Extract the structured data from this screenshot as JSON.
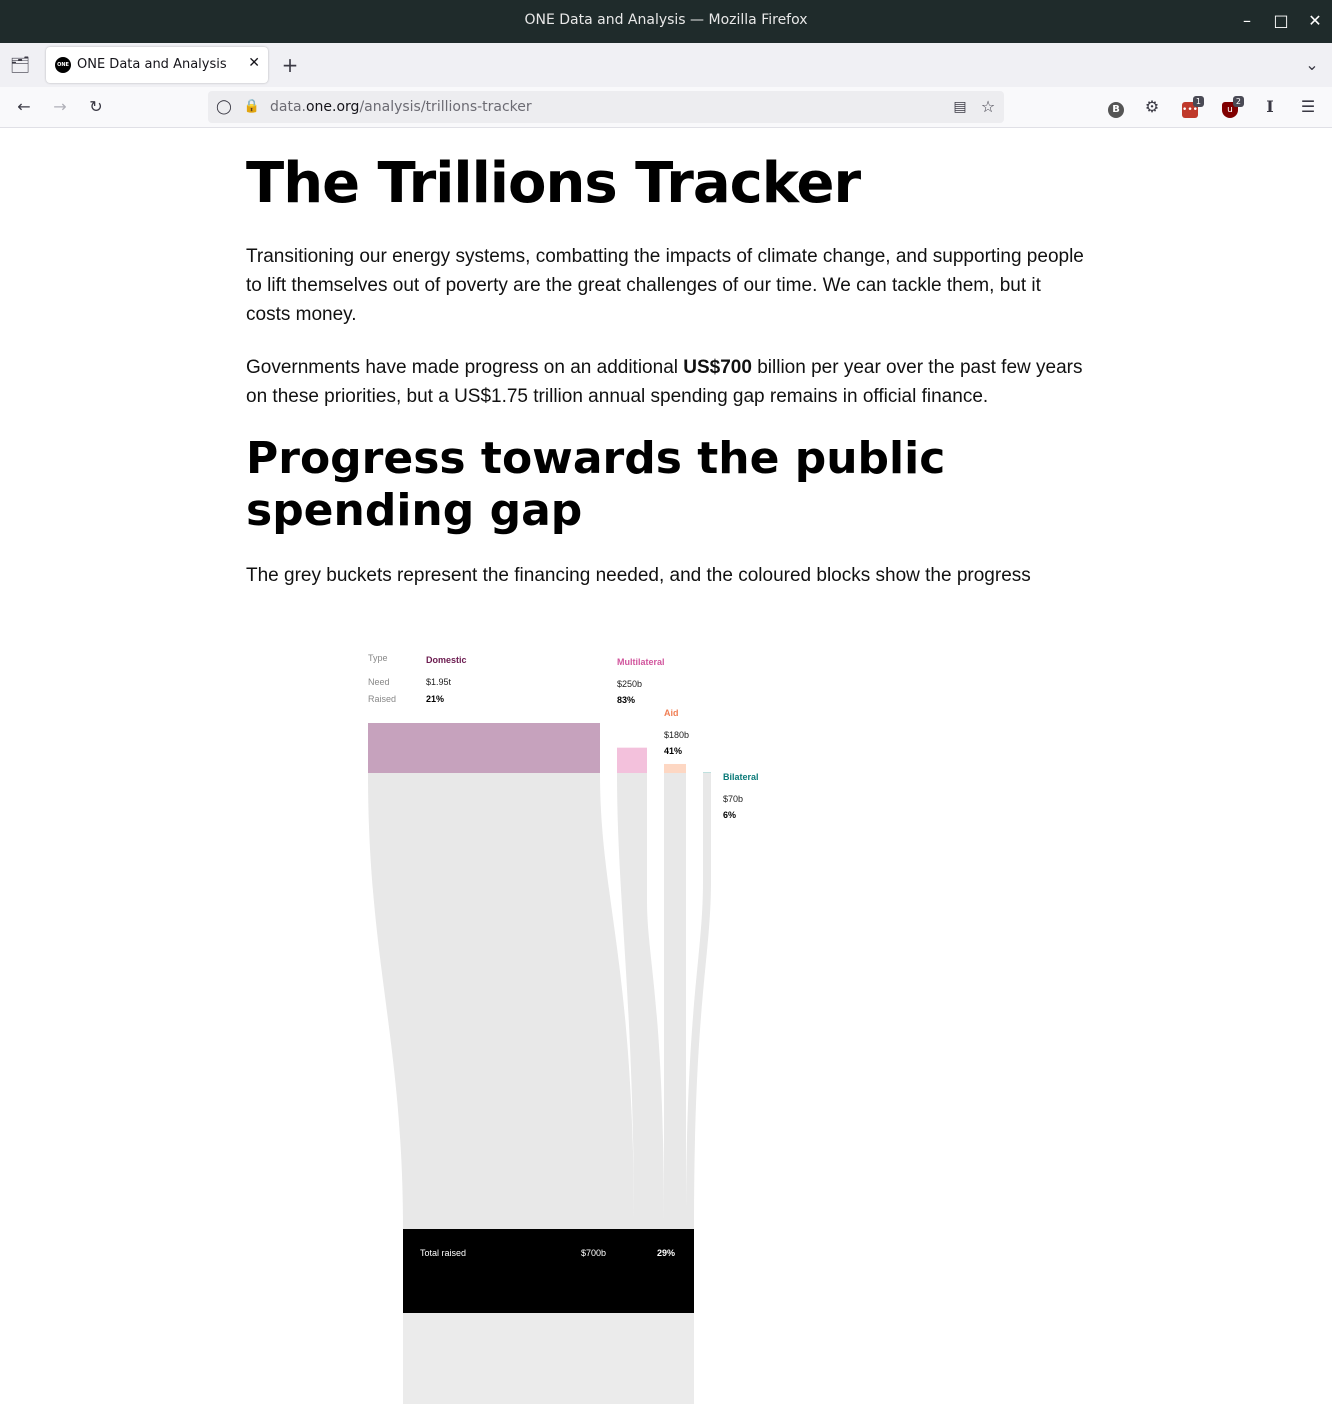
{
  "window": {
    "title": "ONE Data and Analysis — Mozilla Firefox"
  },
  "tabs": [
    {
      "label": "ONE Data and Analysis",
      "favicon_text": "ONE"
    }
  ],
  "navbar": {
    "url_prefix": "data.",
    "url_domain": "one.org",
    "url_path": "/analysis/trillions-tracker",
    "extension_badges": [
      "1",
      "2"
    ]
  },
  "page": {
    "title": "The Trillions Tracker",
    "intro": "Transitioning our energy systems, combatting the impacts of climate change, and supporting people to lift themselves out of poverty are the great challenges of our time. We can tackle them, but it costs money.",
    "progress_before": "Governments have made progress on an additional ",
    "progress_bold": "US$700",
    "progress_after": " billion per year over the past few years on these priorities, but a US$1.75 trillion annual spending gap remains in official finance.",
    "section_heading": "Progress towards the public spending gap",
    "section_text": "The grey buckets represent the financing needed, and the coloured blocks show the progress"
  },
  "chart_data": {
    "type": "sankey",
    "legend_labels": {
      "type": "Type",
      "need": "Need",
      "raised": "Raised"
    },
    "categories": [
      {
        "name": "Domestic",
        "need": "$1.95t",
        "raised": "21%",
        "need_value": 1950,
        "raised_pct": 21,
        "color": "#c6a2bd",
        "label_color": "#6b1a4f"
      },
      {
        "name": "Multilateral",
        "need": "$250b",
        "raised": "83%",
        "need_value": 250,
        "raised_pct": 83,
        "color": "#f3c1dc",
        "label_color": "#d1559d"
      },
      {
        "name": "Aid",
        "need": "$180b",
        "raised": "41%",
        "need_value": 180,
        "raised_pct": 41,
        "color": "#fdd7c3",
        "label_color": "#f07f55"
      },
      {
        "name": "Bilateral",
        "need": "$70b",
        "raised": "6%",
        "need_value": 70,
        "raised_pct": 6,
        "color": "#bfe0de",
        "label_color": "#0a7a78"
      }
    ],
    "total": {
      "label": "Total raised",
      "value": "$700b",
      "pct": "29%"
    },
    "colors": {
      "bucket": "#e8e8e8",
      "total_bar": "#000000"
    }
  }
}
